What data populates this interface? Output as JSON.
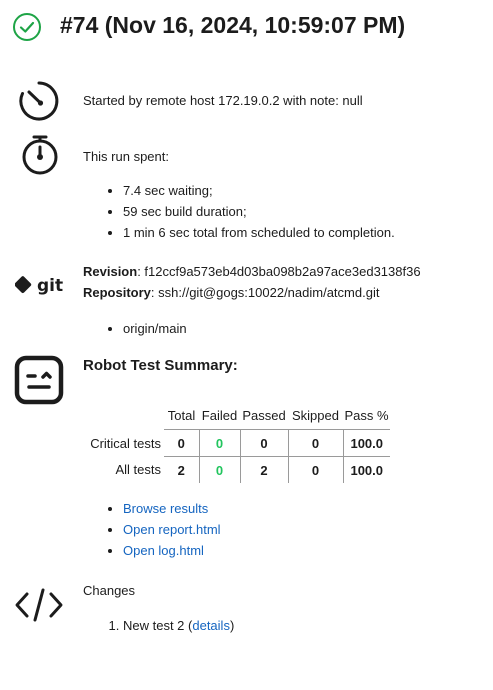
{
  "header": {
    "title": "#74 (Nov 16, 2024, 10:59:07 PM)",
    "status_icon": "check-circle-icon",
    "status_color": "#1ea446"
  },
  "started": {
    "icon": "timer-icon",
    "text": "Started by remote host 172.19.0.2 with note: null"
  },
  "timing": {
    "icon": "stopwatch-icon",
    "heading": "This run spent:",
    "items": [
      "7.4 sec waiting;",
      "59 sec build duration;",
      "1 min 6 sec total from scheduled to completion."
    ]
  },
  "git": {
    "icon": "git-logo",
    "revision_label": "Revision",
    "revision_value": ": f12ccf9a573eb4d03ba098b2a97ace3ed3138f36",
    "repository_label": "Repository",
    "repository_value": ": ssh://git@gogs:10022/nadim/atcmd.git",
    "branches": [
      "origin/main"
    ]
  },
  "robot": {
    "icon": "robot-icon",
    "heading": "Robot Test Summary:",
    "columns": [
      "Total",
      "Failed",
      "Passed",
      "Skipped",
      "Pass %"
    ],
    "rows": [
      {
        "label": "Critical tests",
        "total": "0",
        "failed": "0",
        "passed": "0",
        "skipped": "0",
        "pass_pct": "100.0"
      },
      {
        "label": "All tests",
        "total": "2",
        "failed": "0",
        "passed": "2",
        "skipped": "0",
        "pass_pct": "100.0"
      }
    ],
    "links": [
      "Browse results",
      "Open report.html",
      "Open log.html"
    ],
    "failed_color": "#22c55e",
    "link_color": "#1565c0"
  },
  "changes": {
    "icon": "code-icon",
    "heading": "Changes",
    "items": [
      {
        "text": "New test 2 (",
        "link": "details",
        "suffix": ")"
      }
    ]
  }
}
